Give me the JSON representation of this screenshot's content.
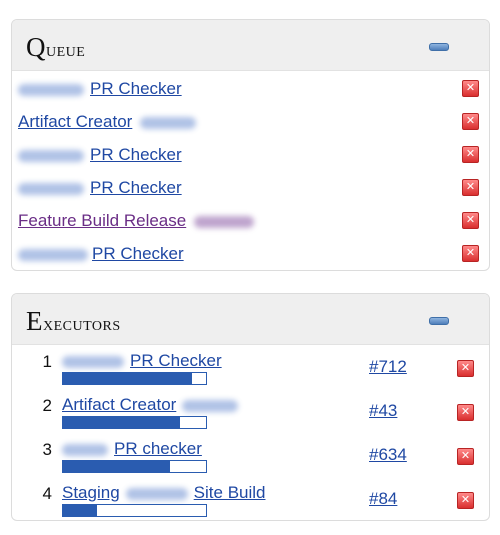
{
  "queue": {
    "title_initial": "Q",
    "title_rest": "ueue",
    "items": [
      {
        "label": "PR Checker",
        "redacted": true,
        "blur_after": false,
        "visited": false
      },
      {
        "label": "Artifact Creator",
        "redacted": true,
        "blur_after": true,
        "visited": false
      },
      {
        "label": "PR Checker",
        "redacted": true,
        "blur_after": false,
        "visited": false
      },
      {
        "label": "PR Checker",
        "redacted": true,
        "blur_after": false,
        "visited": false
      },
      {
        "label": "Feature Build Release",
        "redacted": true,
        "blur_after": true,
        "visited": true
      },
      {
        "label": "PR Checker",
        "redacted": true,
        "blur_after": false,
        "visited": false
      }
    ],
    "cancel_symbol": "✕"
  },
  "executors": {
    "title_initial": "E",
    "title_rest": "xecutors",
    "items": [
      {
        "number": "1",
        "label_pre": "",
        "label_post": "PR Checker",
        "progress": 0.9,
        "build": "#712"
      },
      {
        "number": "2",
        "label_pre": "Artifact Creator",
        "label_post": "",
        "progress": 0.82,
        "build": "#43"
      },
      {
        "number": "3",
        "label_pre": "",
        "label_post": "PR checker",
        "progress": 0.75,
        "build": "#634"
      },
      {
        "number": "4",
        "label_pre": "Staging",
        "label_post": "Site Build",
        "progress": 0.24,
        "build": "#84"
      }
    ],
    "cancel_symbol": "✕"
  },
  "colors": {
    "link": "#1f48a3",
    "visited_link": "#6a2d86",
    "progress": "#2a5cb0",
    "cancel": "#d92f2f",
    "header_bg": "#efefef"
  }
}
